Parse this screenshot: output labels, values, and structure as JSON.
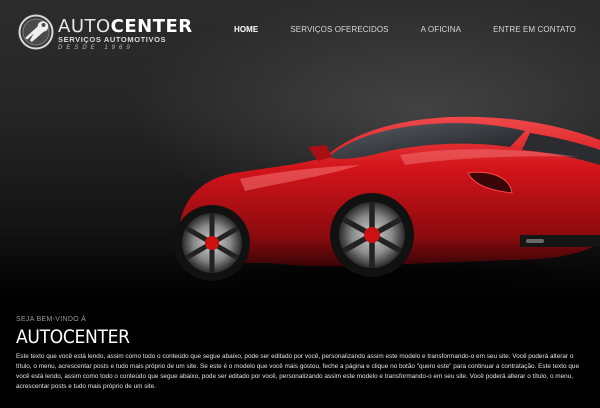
{
  "header": {
    "brand": {
      "name_part1": "AUTO",
      "name_part2": "CENTER",
      "tagline": "SERVIÇOS AUTOMOTIVOS",
      "since": "DESDE 1969"
    },
    "nav": [
      {
        "label": "HOME",
        "active": true
      },
      {
        "label": "SERVIÇOS OFERECIDOS",
        "active": false
      },
      {
        "label": "A OFICINA",
        "active": false
      },
      {
        "label": "ENTRE EM CONTATO",
        "active": false
      }
    ]
  },
  "hero": {
    "image": "red-sports-car",
    "colors": {
      "car_body": "#d2141a",
      "background": "#262626"
    }
  },
  "main": {
    "welcome": "SEJA BEM-VINDO À",
    "title": "AUTOCENTER",
    "paragraph": "Este texto que você está lendo, assim como todo o conteúdo que segue abaixo, pode ser editado por você, personalizando assim este modelo e transformando-o em seu site. Você poderá alterar o título, o menu, acrescentar posts e tudo mais próprio de um site. Se este é o modelo que você mais gostou, feche a página e clique no botão \"quero este\" para continuar a contratação. Este texto que você está lendo, assim como todo o conteúdo que segue abaixo, pode ser editado por você, personalizando assim este modelo e transformando-o em seu site. Você poderá alterar o título, o menu, acrescentar posts e tudo mais próprio de um site."
  }
}
